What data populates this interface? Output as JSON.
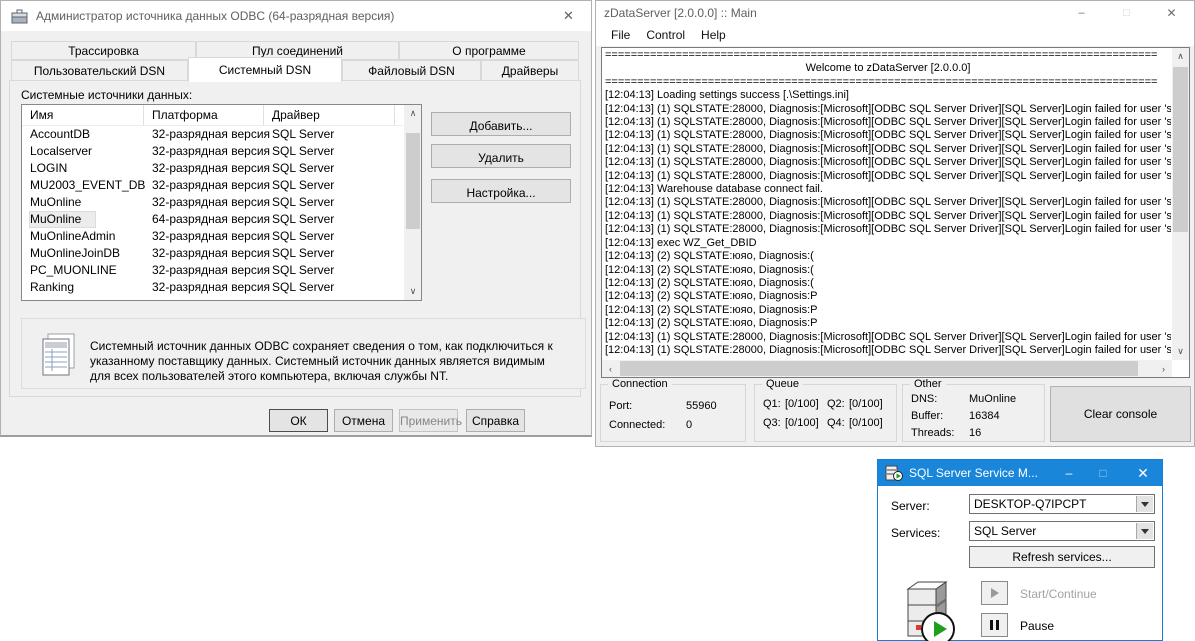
{
  "colors": {
    "accent_blue": "#1a86d9",
    "window_bg": "#f0f0f0",
    "console_bg": "#ffffff",
    "selection_gray": "#ececec",
    "status_green": "#1f9e1f"
  },
  "icons": {
    "close_icon": "✕",
    "minimize_icon": "–",
    "maximize_icon": "□",
    "scroll_up_icon": "∧",
    "scroll_down_icon": "∨",
    "scroll_left_icon": "‹",
    "scroll_right_icon": "›"
  },
  "odbc_window": {
    "title": "Администратор источника данных ODBC (64-разрядная версия)",
    "tabs_row1": [
      "Трассировка",
      "Пул соединений",
      "О программе"
    ],
    "tabs_row2": [
      "Пользовательский DSN",
      "Системный DSN",
      "Файловый DSN",
      "Драйверы"
    ],
    "active_tab": "Системный DSN",
    "list_label": "Системные источники данных:",
    "table": {
      "columns": [
        "Имя",
        "Платформа",
        "Драйвер"
      ],
      "selected_row_index": 5,
      "rows": [
        [
          "AccountDB",
          "32-разрядная версия",
          "SQL Server"
        ],
        [
          "Localserver",
          "32-разрядная версия",
          "SQL Server"
        ],
        [
          "LOGIN",
          "32-разрядная версия",
          "SQL Server"
        ],
        [
          "MU2003_EVENT_DB",
          "32-разрядная версия",
          "SQL Server"
        ],
        [
          "MuOnline",
          "32-разрядная версия",
          "SQL Server"
        ],
        [
          "MuOnline",
          "64-разрядная версия",
          "SQL Server"
        ],
        [
          "MuOnlineAdmin",
          "32-разрядная версия",
          "SQL Server"
        ],
        [
          "MuOnlineJoinDB",
          "32-разрядная версия",
          "SQL Server"
        ],
        [
          "PC_MUONLINE",
          "32-разрядная версия",
          "SQL Server"
        ],
        [
          "Ranking",
          "32-разрядная версия",
          "SQL Server"
        ]
      ]
    },
    "side_buttons": {
      "add": "Добавить...",
      "remove": "Удалить",
      "configure": "Настройка..."
    },
    "info_text": "Системный источник данных ODBC сохраняет сведения о том, как подключиться к указанному поставщику данных.   Системный источник данных является видимым для всех пользователей этого компьютера, включая службы NT.",
    "footer_buttons": [
      {
        "name": "ok-button",
        "label": "ОК",
        "disabled": false,
        "default": true
      },
      {
        "name": "cancel-button",
        "label": "Отмена",
        "disabled": false,
        "default": false
      },
      {
        "name": "apply-button",
        "label": "Применить",
        "disabled": true,
        "default": false
      },
      {
        "name": "help-button",
        "label": "Справка",
        "disabled": false,
        "default": false
      }
    ]
  },
  "zds_window": {
    "title": "zDataServer [2.0.0.0] :: Main",
    "menu": [
      "File",
      "Control",
      "Help"
    ],
    "console_lines": [
      "======================================================================================",
      "Welcome to zDataServer [2.0.0.0]",
      "======================================================================================",
      "[12:04:13] Loading settings success [.\\Settings.ini]",
      "[12:04:13] (1) SQLSTATE:28000, Diagnosis:[Microsoft][ODBC SQL Server Driver][SQL Server]Login failed for user 'sa'",
      "[12:04:13] (1) SQLSTATE:28000, Diagnosis:[Microsoft][ODBC SQL Server Driver][SQL Server]Login failed for user 'sa'",
      "[12:04:13] (1) SQLSTATE:28000, Diagnosis:[Microsoft][ODBC SQL Server Driver][SQL Server]Login failed for user 'sa'",
      "[12:04:13] (1) SQLSTATE:28000, Diagnosis:[Microsoft][ODBC SQL Server Driver][SQL Server]Login failed for user 'sa'",
      "[12:04:13] (1) SQLSTATE:28000, Diagnosis:[Microsoft][ODBC SQL Server Driver][SQL Server]Login failed for user 'sa'",
      "[12:04:13] (1) SQLSTATE:28000, Diagnosis:[Microsoft][ODBC SQL Server Driver][SQL Server]Login failed for user 'sa'",
      "[12:04:13] Warehouse database connect fail.",
      "[12:04:13] (1) SQLSTATE:28000, Diagnosis:[Microsoft][ODBC SQL Server Driver][SQL Server]Login failed for user 'sa'",
      "[12:04:13] (1) SQLSTATE:28000, Diagnosis:[Microsoft][ODBC SQL Server Driver][SQL Server]Login failed for user 'sa'",
      "[12:04:13] (1) SQLSTATE:28000, Diagnosis:[Microsoft][ODBC SQL Server Driver][SQL Server]Login failed for user 'sa'",
      "[12:04:13] exec WZ_Get_DBID",
      "[12:04:13] (2) SQLSTATE:юяо, Diagnosis:(",
      "[12:04:13] (2) SQLSTATE:юяо, Diagnosis:(",
      "[12:04:13] (2) SQLSTATE:юяо, Diagnosis:(",
      "[12:04:13] (2) SQLSTATE:юяо, Diagnosis:P",
      "[12:04:13] (2) SQLSTATE:юяо, Diagnosis:P",
      "[12:04:13] (2) SQLSTATE:юяо, Diagnosis:P",
      "[12:04:13] (1) SQLSTATE:28000, Diagnosis:[Microsoft][ODBC SQL Server Driver][SQL Server]Login failed for user 'sa'",
      "[12:04:13] (1) SQLSTATE:28000, Diagnosis:[Microsoft][ODBC SQL Server Driver][SQL Server]Login failed for user 'sa'"
    ],
    "connection": {
      "label": "Connection",
      "port_label": "Port:",
      "port": "55960",
      "connected_label": "Connected:",
      "connected": "0"
    },
    "queue": {
      "label": "Queue",
      "items": [
        {
          "label": "Q1:",
          "value": "[0/100]"
        },
        {
          "label": "Q2:",
          "value": "[0/100]"
        },
        {
          "label": "Q3:",
          "value": "[0/100]"
        },
        {
          "label": "Q4:",
          "value": "[0/100]"
        }
      ]
    },
    "other": {
      "label": "Other",
      "dns_label": "DNS:",
      "dns": "MuOnline",
      "buffer_label": "Buffer:",
      "buffer": "16384",
      "threads_label": "Threads:",
      "threads": "16"
    },
    "clear_button": "Clear console"
  },
  "sql_window": {
    "title": "SQL Server Service M...",
    "server_label": "Server:",
    "server_value": "DESKTOP-Q7IPCPT",
    "services_label": "Services:",
    "services_value": "SQL Server",
    "refresh_button": "Refresh services...",
    "start_button": "Start/Continue",
    "pause_button": "Pause"
  }
}
